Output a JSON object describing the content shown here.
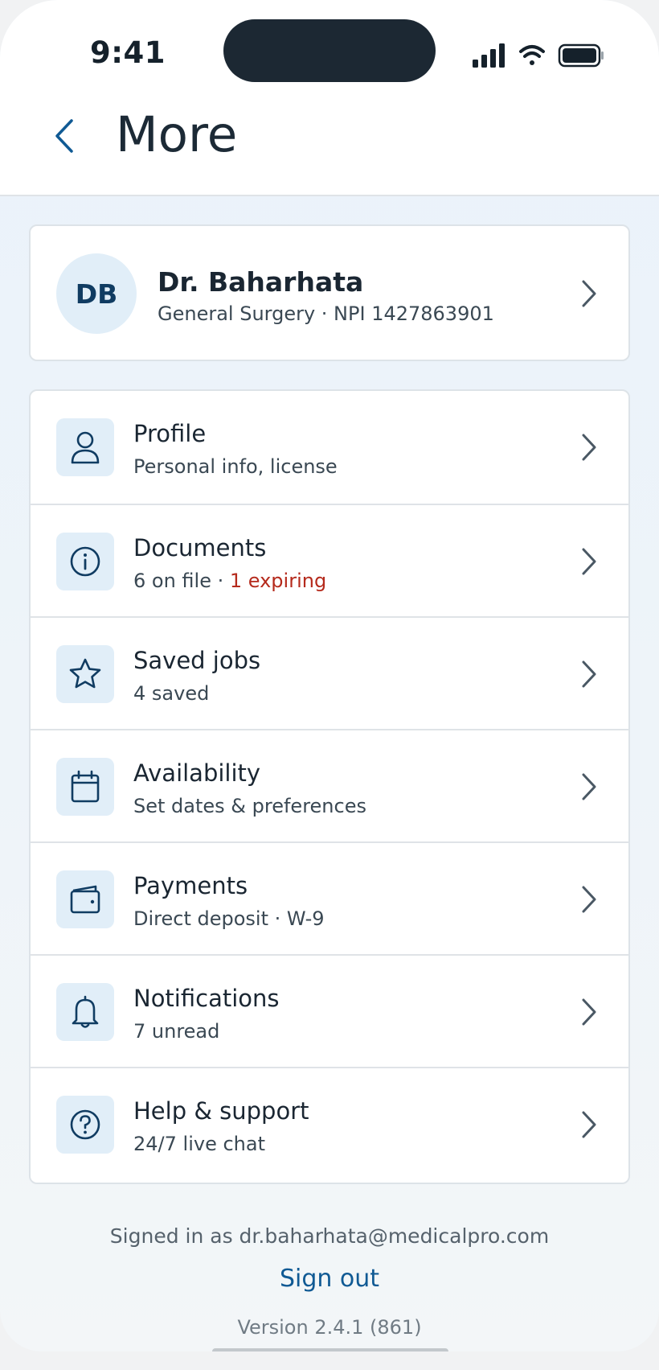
{
  "status_bar": {
    "time": "9:41"
  },
  "header": {
    "title": "More"
  },
  "profile": {
    "initials": "DB",
    "name": "Dr. Baharhata",
    "meta": "General Surgery · NPI 1427863901"
  },
  "menu": {
    "items": [
      {
        "label": "Profile",
        "sub": "Personal info, license",
        "icon": "user-icon"
      },
      {
        "label": "Documents",
        "sub": "6 on file · ",
        "sub_alert": "1 expiring",
        "icon": "info-icon"
      },
      {
        "label": "Saved jobs",
        "sub": "4 saved",
        "icon": "star-icon"
      },
      {
        "label": "Availability",
        "sub": "Set dates & preferences",
        "icon": "calendar-icon"
      },
      {
        "label": "Payments",
        "sub": "Direct deposit · W-9",
        "icon": "wallet-icon"
      },
      {
        "label": "Notifications",
        "sub": "7 unread",
        "icon": "bell-icon"
      },
      {
        "label": "Help & support",
        "sub": "24/7 live chat",
        "icon": "help-icon"
      }
    ]
  },
  "footer": {
    "signed_in": "Signed in as dr.baharhata@medicalpro.com",
    "sign_out": "Sign out",
    "version": "Version 2.4.1 (861)"
  },
  "colors": {
    "accent": "#105a94",
    "alert": "#b52a1c",
    "icon_tile": "#e1eef8"
  }
}
